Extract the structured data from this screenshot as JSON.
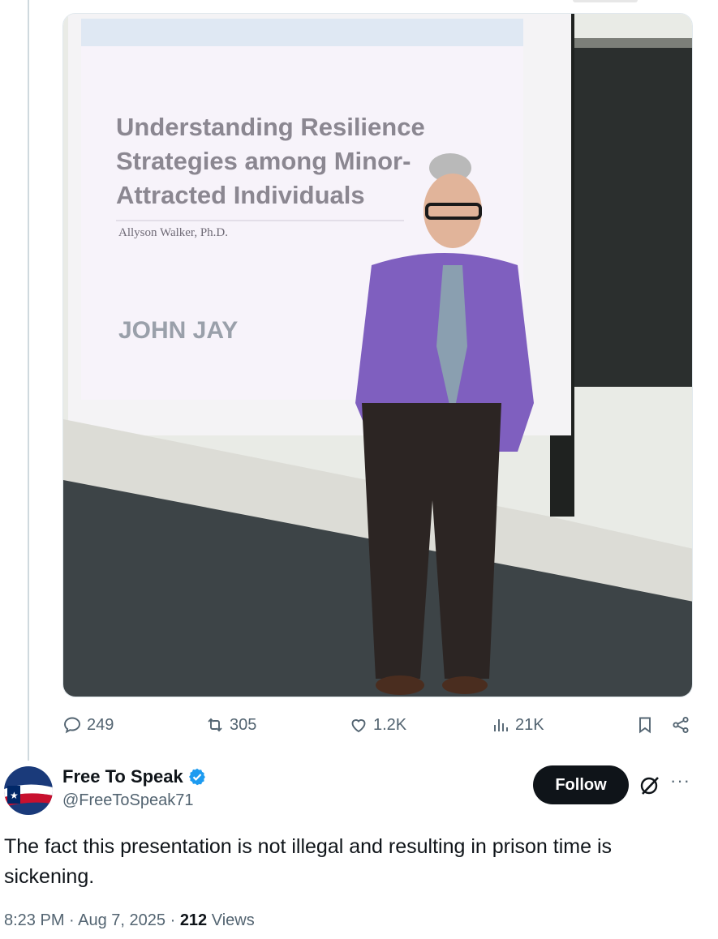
{
  "media": {
    "slide_title_lines": [
      "Understanding Resilience",
      "Strategies among Minor-",
      "Attracted Individuals"
    ],
    "slide_author": "Allyson Walker, Ph.D.",
    "slide_logo": "JOHN JAY"
  },
  "actions": {
    "replies": "249",
    "reposts": "305",
    "likes": "1.2K",
    "views": "21K"
  },
  "post": {
    "display_name": "Free To Speak",
    "handle": "@FreeToSpeak71",
    "follow_label": "Follow",
    "more_label": "···",
    "text": "The fact this presentation is not illegal and resulting in prison time is sickening.",
    "time": "8:23 PM",
    "separator": " · ",
    "date": "Aug 7, 2025",
    "views_count": "212",
    "views_label": "Views"
  }
}
